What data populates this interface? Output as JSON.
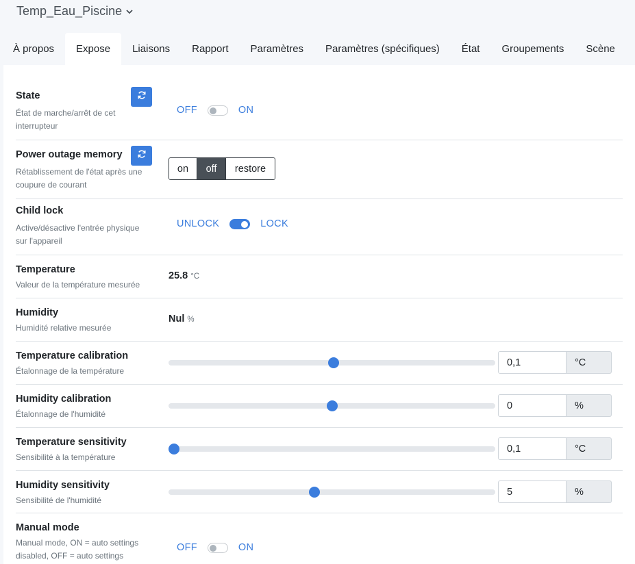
{
  "header": {
    "device_name": "Temp_Eau_Piscine"
  },
  "tabs": [
    {
      "label": "À propos"
    },
    {
      "label": "Expose"
    },
    {
      "label": "Liaisons"
    },
    {
      "label": "Rapport"
    },
    {
      "label": "Paramètres"
    },
    {
      "label": "Paramètres (spécifiques)"
    },
    {
      "label": "État"
    },
    {
      "label": "Groupements"
    },
    {
      "label": "Scène"
    }
  ],
  "active_tab": "Expose",
  "rows": {
    "state": {
      "title": "State",
      "desc_line1": "État de marche/arrêt de cet",
      "desc_line2": "interrupteur",
      "off_label": "OFF",
      "on_label": "ON",
      "value": "OFF"
    },
    "power_outage": {
      "title": "Power outage memory",
      "desc_line1": "Rétablissement de l'état après une",
      "desc_line2": "coupure de courant",
      "options": [
        "on",
        "off",
        "restore"
      ],
      "selected": "off"
    },
    "child_lock": {
      "title": "Child lock",
      "desc_line1": "Active/désactive l'entrée physique",
      "desc_line2": "sur l'appareil",
      "off_label": "UNLOCK",
      "on_label": "LOCK",
      "value": "LOCK"
    },
    "temperature": {
      "title": "Temperature",
      "desc": "Valeur de la température mesurée",
      "value": "25.8",
      "unit": "°C"
    },
    "humidity": {
      "title": "Humidity",
      "desc": "Humidité relative mesurée",
      "value": "Nul",
      "unit": "%"
    },
    "temperature_calibration": {
      "title": "Temperature calibration",
      "desc": "Étalonnage de la température",
      "value": "0,1",
      "unit": "°C",
      "slider_fraction": 0.505
    },
    "humidity_calibration": {
      "title": "Humidity calibration",
      "desc": "Étalonnage de l'humidité",
      "value": "0",
      "unit": "%",
      "slider_fraction": 0.5
    },
    "temperature_sensitivity": {
      "title": "Temperature sensitivity",
      "desc": "Sensibilité à la température",
      "value": "0,1",
      "unit": "°C",
      "slider_fraction": 0.016
    },
    "humidity_sensitivity": {
      "title": "Humidity sensitivity",
      "desc": "Sensibilité de l'humidité",
      "value": "5",
      "unit": "%",
      "slider_fraction": 0.447
    },
    "manual_mode": {
      "title": "Manual mode",
      "desc_line1": "Manual mode, ON = auto settings",
      "desc_line2": "disabled, OFF = auto settings",
      "off_label": "OFF",
      "on_label": "ON",
      "value": "OFF"
    }
  },
  "colors": {
    "accent": "#3b7ddd",
    "active_segment": "#495057"
  },
  "icons": {
    "refresh": "refresh-icon",
    "dropdown": "chevron-down-icon"
  }
}
